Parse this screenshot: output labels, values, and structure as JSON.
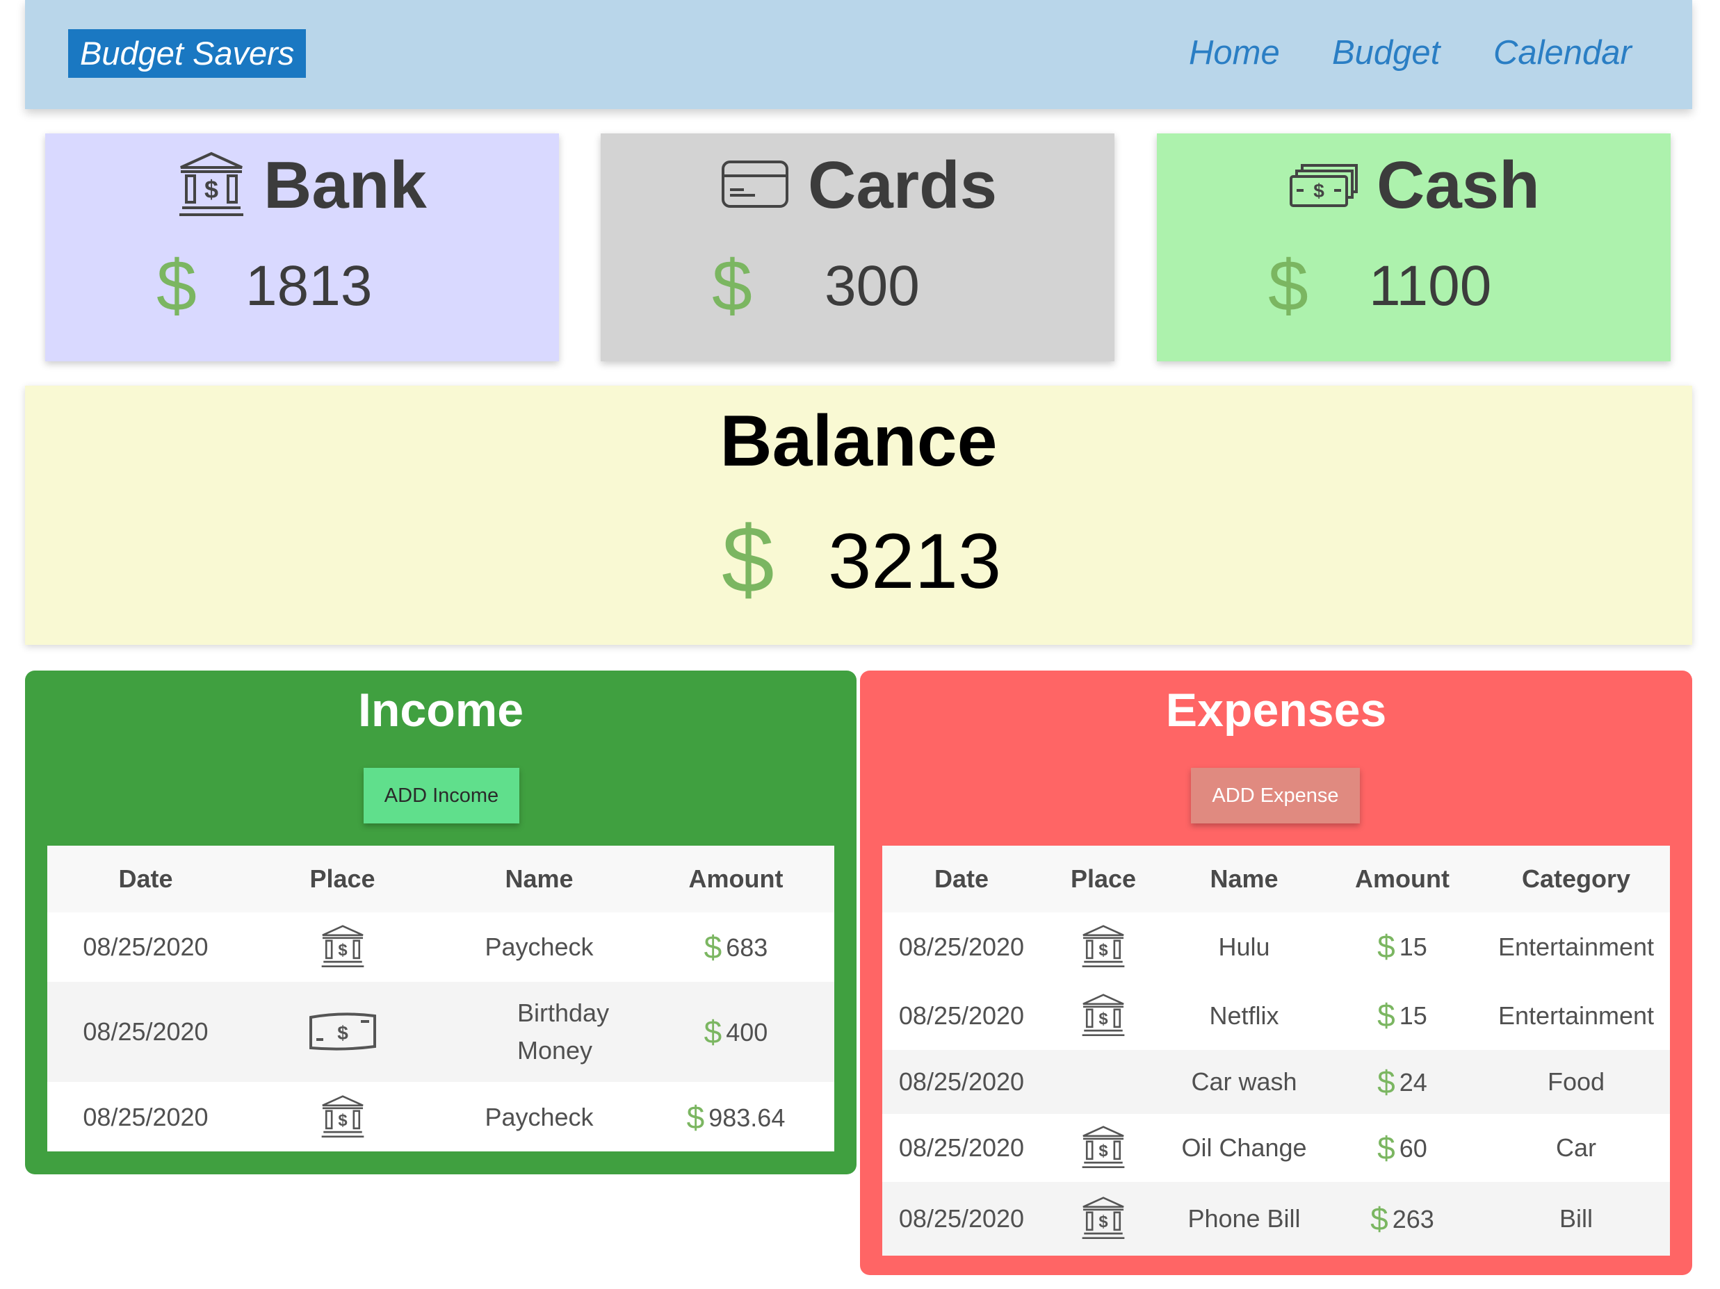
{
  "navbar": {
    "brand": "Budget Savers",
    "links": [
      "Home",
      "Budget",
      "Calendar"
    ]
  },
  "accounts": [
    {
      "title": "Bank",
      "icon": "bank-icon",
      "currency": "$",
      "value": "1813",
      "color": "#d9d9ff"
    },
    {
      "title": "Cards",
      "icon": "credit-card-icon",
      "currency": "$",
      "value": "300",
      "color": "#d3d3d3"
    },
    {
      "title": "Cash",
      "icon": "cash-icon",
      "currency": "$",
      "value": "1100",
      "color": "#adf2ad"
    }
  ],
  "balance": {
    "title": "Balance",
    "currency": "$",
    "value": "3213"
  },
  "income": {
    "title": "Income",
    "add_label": "ADD Income",
    "headers": [
      "Date",
      "Place",
      "Name",
      "Amount"
    ],
    "rows": [
      {
        "date": "08/25/2020",
        "place_icon": "bank-icon",
        "name": "Paycheck",
        "currency": "$",
        "amount": "683"
      },
      {
        "date": "08/25/2020",
        "place_icon": "cash-icon",
        "name": "Birthday Money",
        "currency": "$",
        "amount": "400"
      },
      {
        "date": "08/25/2020",
        "place_icon": "bank-icon",
        "name": "Paycheck",
        "currency": "$",
        "amount": "983.64"
      }
    ]
  },
  "expenses": {
    "title": "Expenses",
    "add_label": "ADD Expense",
    "headers": [
      "Date",
      "Place",
      "Name",
      "Amount",
      "Category"
    ],
    "rows": [
      {
        "date": "08/25/2020",
        "place_icon": "bank-icon",
        "name": "Hulu",
        "currency": "$",
        "amount": "15",
        "category": "Entertainment"
      },
      {
        "date": "08/25/2020",
        "place_icon": "bank-icon",
        "name": "Netflix",
        "currency": "$",
        "amount": "15",
        "category": "Entertainment"
      },
      {
        "date": "08/25/2020",
        "place_icon": "",
        "name": "Car wash",
        "currency": "$",
        "amount": "24",
        "category": "Food"
      },
      {
        "date": "08/25/2020",
        "place_icon": "bank-icon",
        "name": "Oil Change",
        "currency": "$",
        "amount": "60",
        "category": "Car"
      },
      {
        "date": "08/25/2020",
        "place_icon": "bank-icon",
        "name": "Phone Bill",
        "currency": "$",
        "amount": "263",
        "category": "Bill"
      }
    ]
  }
}
